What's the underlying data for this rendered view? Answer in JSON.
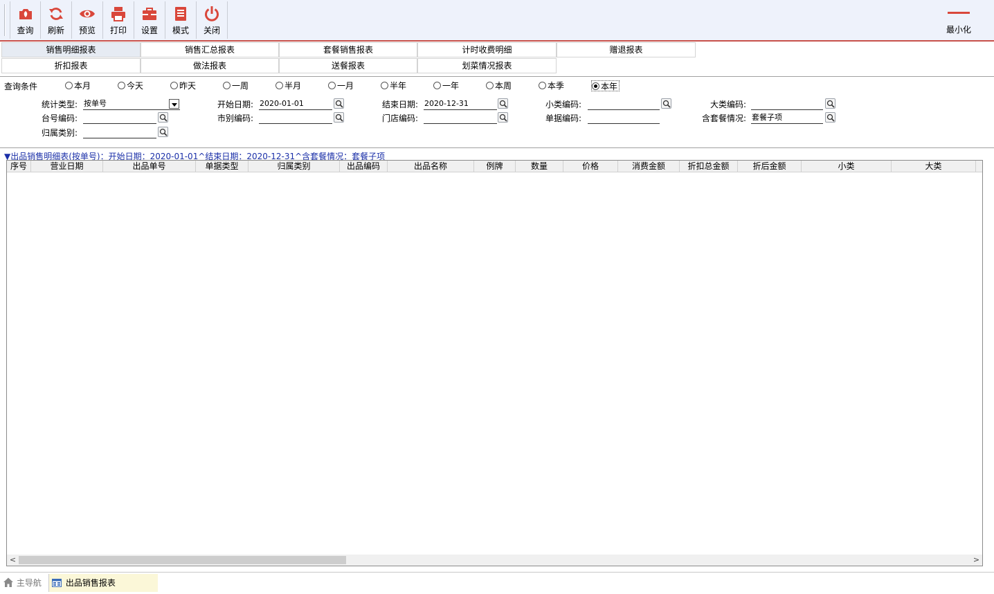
{
  "toolbar": {
    "buttons": [
      {
        "label": "查询",
        "icon": "query-icon"
      },
      {
        "label": "刷新",
        "icon": "refresh-icon"
      },
      {
        "label": "预览",
        "icon": "eye-icon"
      },
      {
        "label": "打印",
        "icon": "printer-icon"
      },
      {
        "label": "设置",
        "icon": "briefcase-icon"
      },
      {
        "label": "模式",
        "icon": "document-icon"
      },
      {
        "label": "关闭",
        "icon": "power-icon"
      }
    ],
    "minimize_label": "最小化",
    "accent_color": "#d9473b"
  },
  "report_tabs": [
    {
      "label": "销售明细报表",
      "active": true
    },
    {
      "label": "销售汇总报表",
      "active": false
    },
    {
      "label": "套餐销售报表",
      "active": false
    },
    {
      "label": "计时收费明细",
      "active": false
    },
    {
      "label": "赠退报表",
      "active": false
    },
    {
      "label": "折扣报表",
      "active": false
    },
    {
      "label": "做法报表",
      "active": false
    },
    {
      "label": "送餐报表",
      "active": false
    },
    {
      "label": "划菜情况报表",
      "active": false
    }
  ],
  "query": {
    "title": "查询条件",
    "periods": [
      {
        "label": "本月",
        "selected": false
      },
      {
        "label": "今天",
        "selected": false
      },
      {
        "label": "昨天",
        "selected": false
      },
      {
        "label": "一周",
        "selected": false
      },
      {
        "label": "半月",
        "selected": false
      },
      {
        "label": "一月",
        "selected": false
      },
      {
        "label": "半年",
        "selected": false
      },
      {
        "label": "一年",
        "selected": false
      },
      {
        "label": "本周",
        "selected": false
      },
      {
        "label": "本季",
        "selected": false
      },
      {
        "label": "本年",
        "selected": true
      }
    ],
    "fields": {
      "stat_type": {
        "label": "统计类型:",
        "value": "按单号"
      },
      "start_date": {
        "label": "开始日期:",
        "value": "2020-01-01"
      },
      "end_date": {
        "label": "结束日期:",
        "value": "2020-12-31"
      },
      "small_cat": {
        "label": "小类编码:",
        "value": ""
      },
      "big_cat": {
        "label": "大类编码:",
        "value": ""
      },
      "table_no": {
        "label": "台号编码:",
        "value": ""
      },
      "market": {
        "label": "市别编码:",
        "value": ""
      },
      "store": {
        "label": "门店编码:",
        "value": ""
      },
      "bill": {
        "label": "单据编码:",
        "value": ""
      },
      "set_meal": {
        "label": "含套餐情况:",
        "value": "套餐子项"
      },
      "belong": {
        "label": "归属类别:",
        "value": ""
      }
    }
  },
  "grid": {
    "caption": "▼出品销售明细表(按单号)：开始日期：2020-01-01^结束日期：2020-12-31^含套餐情况：套餐子项",
    "columns": [
      "序号",
      "营业日期",
      "出品单号",
      "单据类型",
      "归属类别",
      "出品编码",
      "出品名称",
      "例牌",
      "数量",
      "价格",
      "消费金额",
      "折扣总金额",
      "折后金额",
      "小类",
      "大类"
    ],
    "rows": []
  },
  "status_bar": {
    "home_label": "主导航",
    "active_tab_label": "出品销售报表"
  }
}
